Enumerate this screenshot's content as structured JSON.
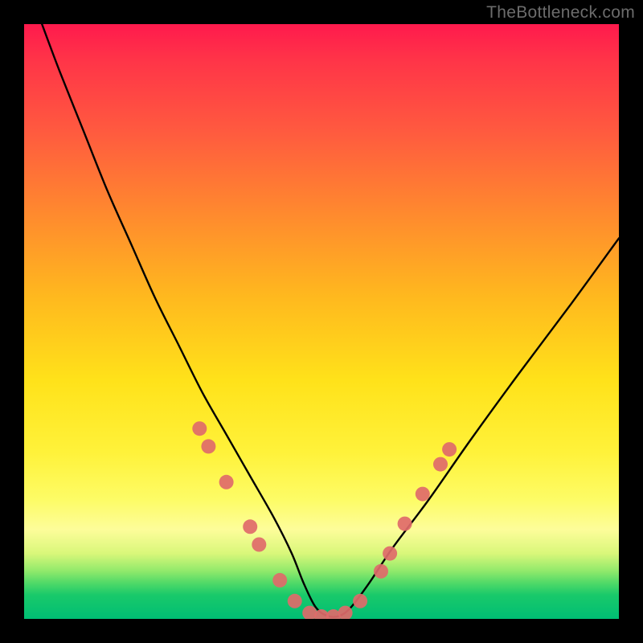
{
  "watermark": "TheBottleneck.com",
  "chart_data": {
    "type": "line",
    "title": "",
    "xlabel": "",
    "ylabel": "",
    "xlim": [
      0,
      100
    ],
    "ylim": [
      0,
      100
    ],
    "series": [
      {
        "name": "bottleneck-curve",
        "x": [
          3,
          6,
          10,
          14,
          18,
          22,
          26,
          30,
          34,
          38,
          42,
          45,
          47,
          49,
          51,
          53,
          55,
          58,
          62,
          68,
          75,
          83,
          92,
          100
        ],
        "y": [
          100,
          92,
          82,
          72,
          63,
          54,
          46,
          38,
          31,
          24,
          17,
          11,
          6,
          2,
          0.5,
          0.5,
          2,
          6,
          12,
          20,
          30,
          41,
          53,
          64
        ]
      }
    ],
    "markers": {
      "name": "highlight-dots",
      "color": "#e06a6a",
      "points": [
        {
          "x": 29.5,
          "y": 32
        },
        {
          "x": 31,
          "y": 29
        },
        {
          "x": 34,
          "y": 23
        },
        {
          "x": 38,
          "y": 15.5
        },
        {
          "x": 39.5,
          "y": 12.5
        },
        {
          "x": 43,
          "y": 6.5
        },
        {
          "x": 45.5,
          "y": 3
        },
        {
          "x": 48,
          "y": 1
        },
        {
          "x": 50,
          "y": 0.4
        },
        {
          "x": 52,
          "y": 0.4
        },
        {
          "x": 54,
          "y": 1
        },
        {
          "x": 56.5,
          "y": 3
        },
        {
          "x": 60,
          "y": 8
        },
        {
          "x": 61.5,
          "y": 11
        },
        {
          "x": 64,
          "y": 16
        },
        {
          "x": 67,
          "y": 21
        },
        {
          "x": 70,
          "y": 26
        },
        {
          "x": 71.5,
          "y": 28.5
        }
      ]
    }
  }
}
